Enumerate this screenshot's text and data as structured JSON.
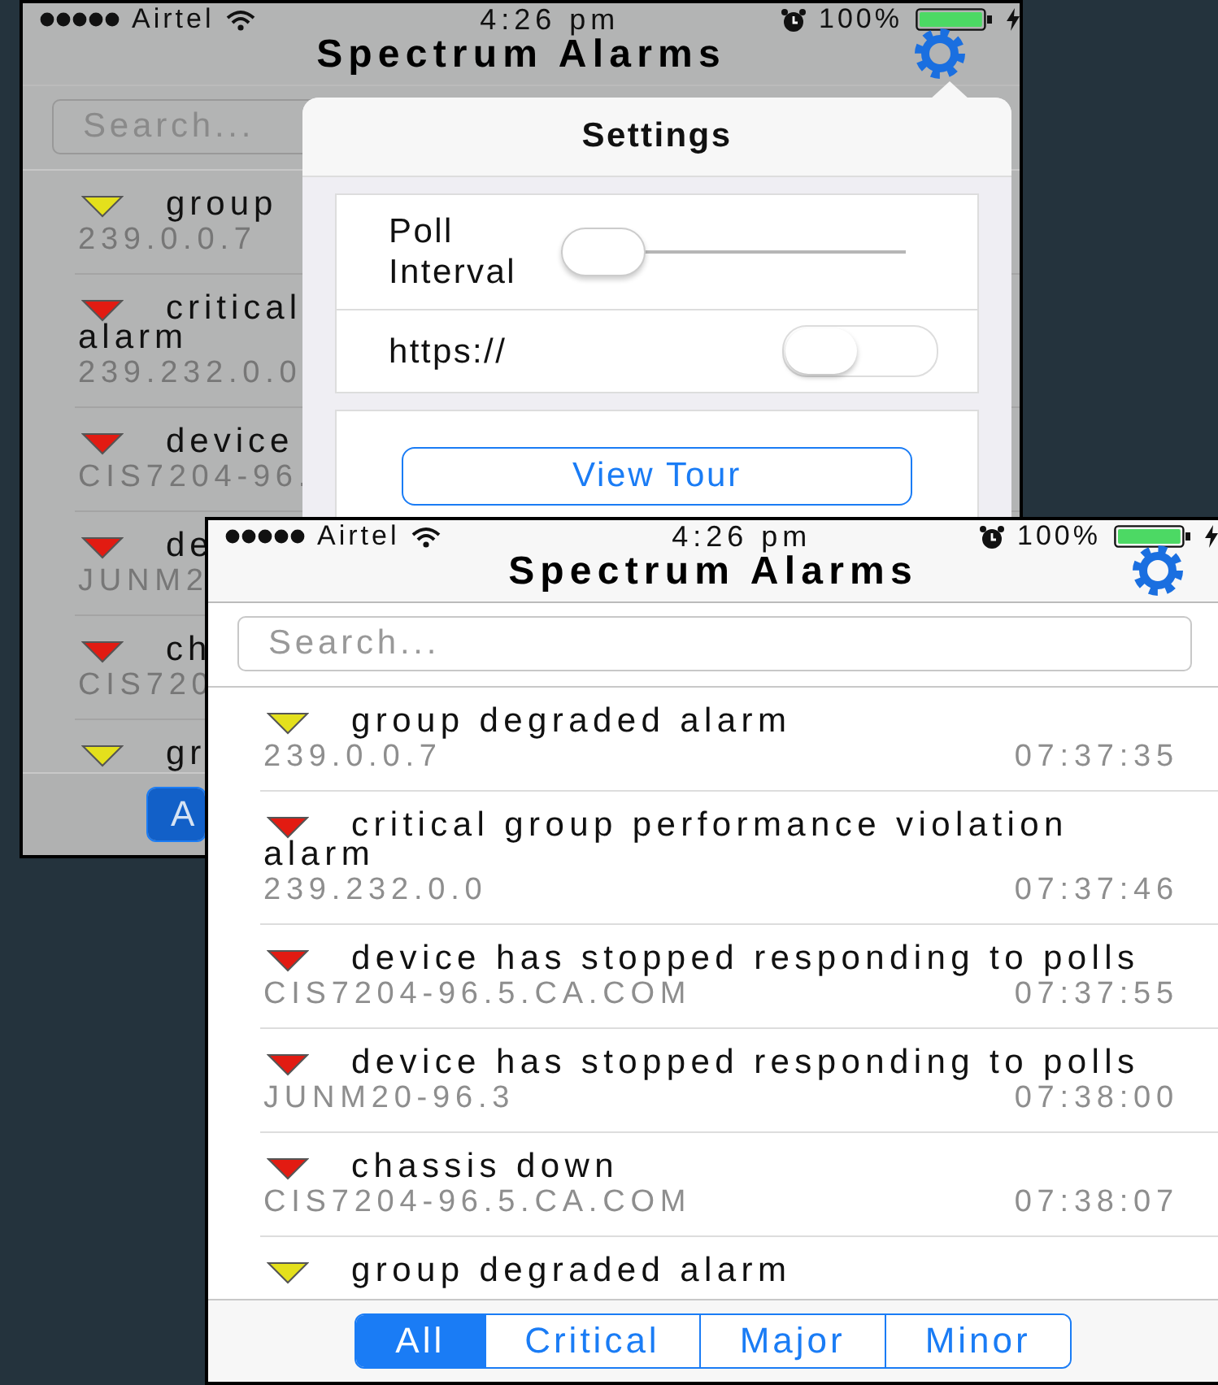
{
  "screens": [
    {
      "kind": "back",
      "dimmed": true,
      "status_bar": {
        "carrier": "Airtel",
        "time": "4:26 pm",
        "battery": "100%"
      },
      "title": "Spectrum Alarms",
      "search": {
        "placeholder": "Search..."
      },
      "alarms": [
        {
          "kind": "minor",
          "title_lines": [
            "group"
          ],
          "source": "239.0.0.7"
        },
        {
          "kind": "critical",
          "title_lines": [
            "critical",
            "alarm"
          ],
          "source": "239.232.0.0"
        },
        {
          "kind": "critical",
          "title_lines": [
            "device"
          ],
          "source": "CIS7204-96."
        },
        {
          "kind": "critical",
          "title_lines": [
            "de"
          ],
          "source": "JUNM2"
        },
        {
          "kind": "critical",
          "title_lines": [
            "ch"
          ],
          "source": "CIS720"
        },
        {
          "kind": "minor",
          "title_lines": [
            "gr"
          ]
        }
      ],
      "filters": [
        {
          "label": "A",
          "selected": true
        }
      ],
      "settings_popover": {
        "title": "Settings",
        "poll_interval": {
          "label": "Poll Interval",
          "level": 0
        },
        "https": {
          "label": "https://",
          "on": false
        },
        "view_tour_button": "View Tour"
      }
    },
    {
      "kind": "front",
      "dimmed": false,
      "status_bar": {
        "carrier": "Airtel",
        "time": "4:26 pm",
        "battery": "100%"
      },
      "title": "Spectrum Alarms",
      "search": {
        "placeholder": "Search..."
      },
      "alarms": [
        {
          "kind": "minor",
          "title": "group degraded alarm",
          "source": "239.0.0.7",
          "time": "07:37:35"
        },
        {
          "kind": "critical",
          "title": "critical group performance violation alarm",
          "source": "239.232.0.0",
          "time": "07:37:46"
        },
        {
          "kind": "critical",
          "title": "device has stopped responding to polls",
          "source": "CIS7204-96.5.CA.COM",
          "time": "07:37:55"
        },
        {
          "kind": "critical",
          "title": "device has stopped responding to polls",
          "source": "JUNM20-96.3",
          "time": "07:38:00"
        },
        {
          "kind": "critical",
          "title": "chassis down",
          "source": "CIS7204-96.5.CA.COM",
          "time": "07:38:07"
        },
        {
          "kind": "minor",
          "title": "group degraded alarm"
        }
      ],
      "filters": [
        {
          "label": "All",
          "selected": true
        },
        {
          "label": "Critical",
          "selected": false
        },
        {
          "label": "Major",
          "selected": false
        },
        {
          "label": "Minor",
          "selected": false
        }
      ]
    }
  ]
}
